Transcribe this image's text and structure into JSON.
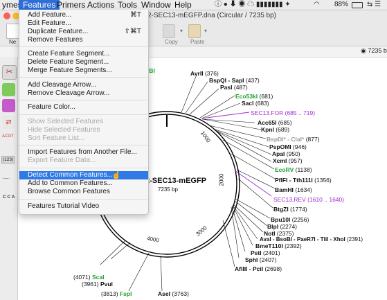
{
  "menubar": {
    "items": [
      "ymes",
      "Features",
      "Primers",
      "Actions",
      "Tools",
      "Window",
      "Help"
    ],
    "active": "Features",
    "battery": "88%"
  },
  "window": {
    "title": "2-SEC13-mEGFP.dna (Circular / 7235 bp)"
  },
  "toolbar": {
    "new_label": "Ne",
    "copy_label": "Copy",
    "paste_label": "Paste",
    "length_readout": "7235 b"
  },
  "tools": {
    "acgt_label": "ACGT",
    "num_label": "(123)",
    "cca_label": "C C A"
  },
  "menu": {
    "items": [
      {
        "label": "Add Feature...",
        "shortcut": "⌘T",
        "disabled": false
      },
      {
        "label": "Edit Feature...",
        "shortcut": "",
        "disabled": false
      },
      {
        "label": "Duplicate Feature...",
        "shortcut": "⇧⌘T",
        "disabled": false
      },
      {
        "label": "Remove Features",
        "shortcut": "",
        "disabled": false
      },
      {
        "label": "Create Feature Segment...",
        "shortcut": "",
        "disabled": false
      },
      {
        "label": "Delete Feature Segment...",
        "shortcut": "",
        "disabled": false
      },
      {
        "label": "Merge Feature Segments...",
        "shortcut": "",
        "disabled": false
      },
      {
        "label": "Add Cleavage Arrow...",
        "shortcut": "",
        "disabled": false
      },
      {
        "label": "Remove Cleavage Arrow...",
        "shortcut": "",
        "disabled": false
      },
      {
        "label": "Feature Color...",
        "shortcut": "",
        "disabled": false
      },
      {
        "label": "Show Selected Features",
        "shortcut": "",
        "disabled": true
      },
      {
        "label": "Hide Selected Features",
        "shortcut": "",
        "disabled": true
      },
      {
        "label": "Sort Feature List...",
        "shortcut": "",
        "disabled": true
      },
      {
        "label": "Import Features from Another File...",
        "shortcut": "",
        "disabled": false
      },
      {
        "label": "Export Feature Data...",
        "shortcut": "",
        "disabled": true
      },
      {
        "label": "Detect Common Features...",
        "shortcut": "",
        "disabled": false,
        "highlighted": true
      },
      {
        "label": "Add to Common Features...",
        "shortcut": "",
        "disabled": false
      },
      {
        "label": "Browse Common Features",
        "shortcut": "",
        "disabled": false
      },
      {
        "label": "Features Tutorial Video",
        "shortcut": "",
        "disabled": false
      }
    ]
  },
  "map": {
    "name": "2-SEC13-mEGFP",
    "size": "7235 bp",
    "ticks": [
      "1000",
      "2000",
      "3000",
      "4000"
    ],
    "partial_left_label": "rBI",
    "sites": [
      {
        "name": "AvrII",
        "pos": "(376)"
      },
      {
        "name": "BspQI - SapI",
        "pos": "(437)"
      },
      {
        "name": "PasI",
        "pos": "(487)"
      },
      {
        "name": "Eco53kI",
        "pos": "(681)"
      },
      {
        "name": "SacI",
        "pos": "(683)"
      },
      {
        "name": "SEC13.FOR",
        "pos": "(685 .. 719)"
      },
      {
        "name": "Acc65I",
        "pos": "(685)"
      },
      {
        "name": "KpnI",
        "pos": "(689)"
      },
      {
        "name": "BspDI* - ClaI*",
        "pos": "(877)"
      },
      {
        "name": "PspOMI",
        "pos": "(946)"
      },
      {
        "name": "ApaI",
        "pos": "(950)"
      },
      {
        "name": "XcmI",
        "pos": "(957)"
      },
      {
        "name": "EcoRV",
        "pos": "(1138)"
      },
      {
        "name": "PflFI - Tth111I",
        "pos": "(1356)"
      },
      {
        "name": "BamHI",
        "pos": "(1634)"
      },
      {
        "name": "SEC13.REV",
        "pos": "(1610 .. 1640)"
      },
      {
        "name": "BtgZI",
        "pos": "(1774)"
      },
      {
        "name": "Bpu10I",
        "pos": "(2256)"
      },
      {
        "name": "BlpI",
        "pos": "(2274)"
      },
      {
        "name": "NotI",
        "pos": "(2375)"
      },
      {
        "name": "AvaI - BsoBI - PaeR7I - TliI - XhoI",
        "pos": "(2391)"
      },
      {
        "name": "BmeT110I",
        "pos": "(2392)"
      },
      {
        "name": "PstI",
        "pos": "(2401)"
      },
      {
        "name": "SphI",
        "pos": "(2407)"
      },
      {
        "name": "AflIII - PciI",
        "pos": "(2698)"
      },
      {
        "name": "AseI",
        "pos": "(3763)"
      },
      {
        "name": "FspI",
        "pos": "(3813)"
      },
      {
        "name": "PvuI",
        "pos": "(3961)"
      },
      {
        "name": "ScaI",
        "pos": "(4071)"
      }
    ]
  },
  "colors": {
    "highlight": "#2f7ae5",
    "enzyme_green": "#1fa02c",
    "primer_purple": "#a02bd0"
  }
}
